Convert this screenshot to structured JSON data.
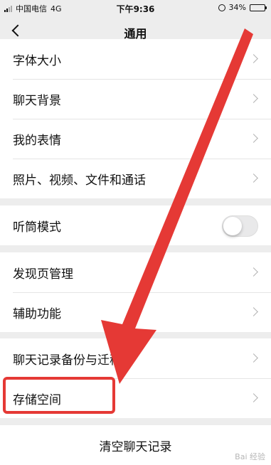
{
  "status_bar": {
    "carrier": "中国电信",
    "network": "4G",
    "time": "下午9:36",
    "battery_text": "34%",
    "battery_level": 0.34
  },
  "nav": {
    "title": "通用",
    "back_icon": "chevron-left-icon"
  },
  "groups": {
    "display": [
      "字体大小",
      "聊天背景",
      "我的表情",
      "照片、视频、文件和通话"
    ],
    "earpiece": {
      "label": "听筒模式",
      "enabled": false
    },
    "features": [
      "发现页管理",
      "辅助功能"
    ],
    "storage": [
      "聊天记录备份与迁移",
      "存储空间"
    ]
  },
  "clear_button": "清空聊天记录",
  "annotation": {
    "color": "#e53935"
  },
  "watermark": "Bai 经验"
}
